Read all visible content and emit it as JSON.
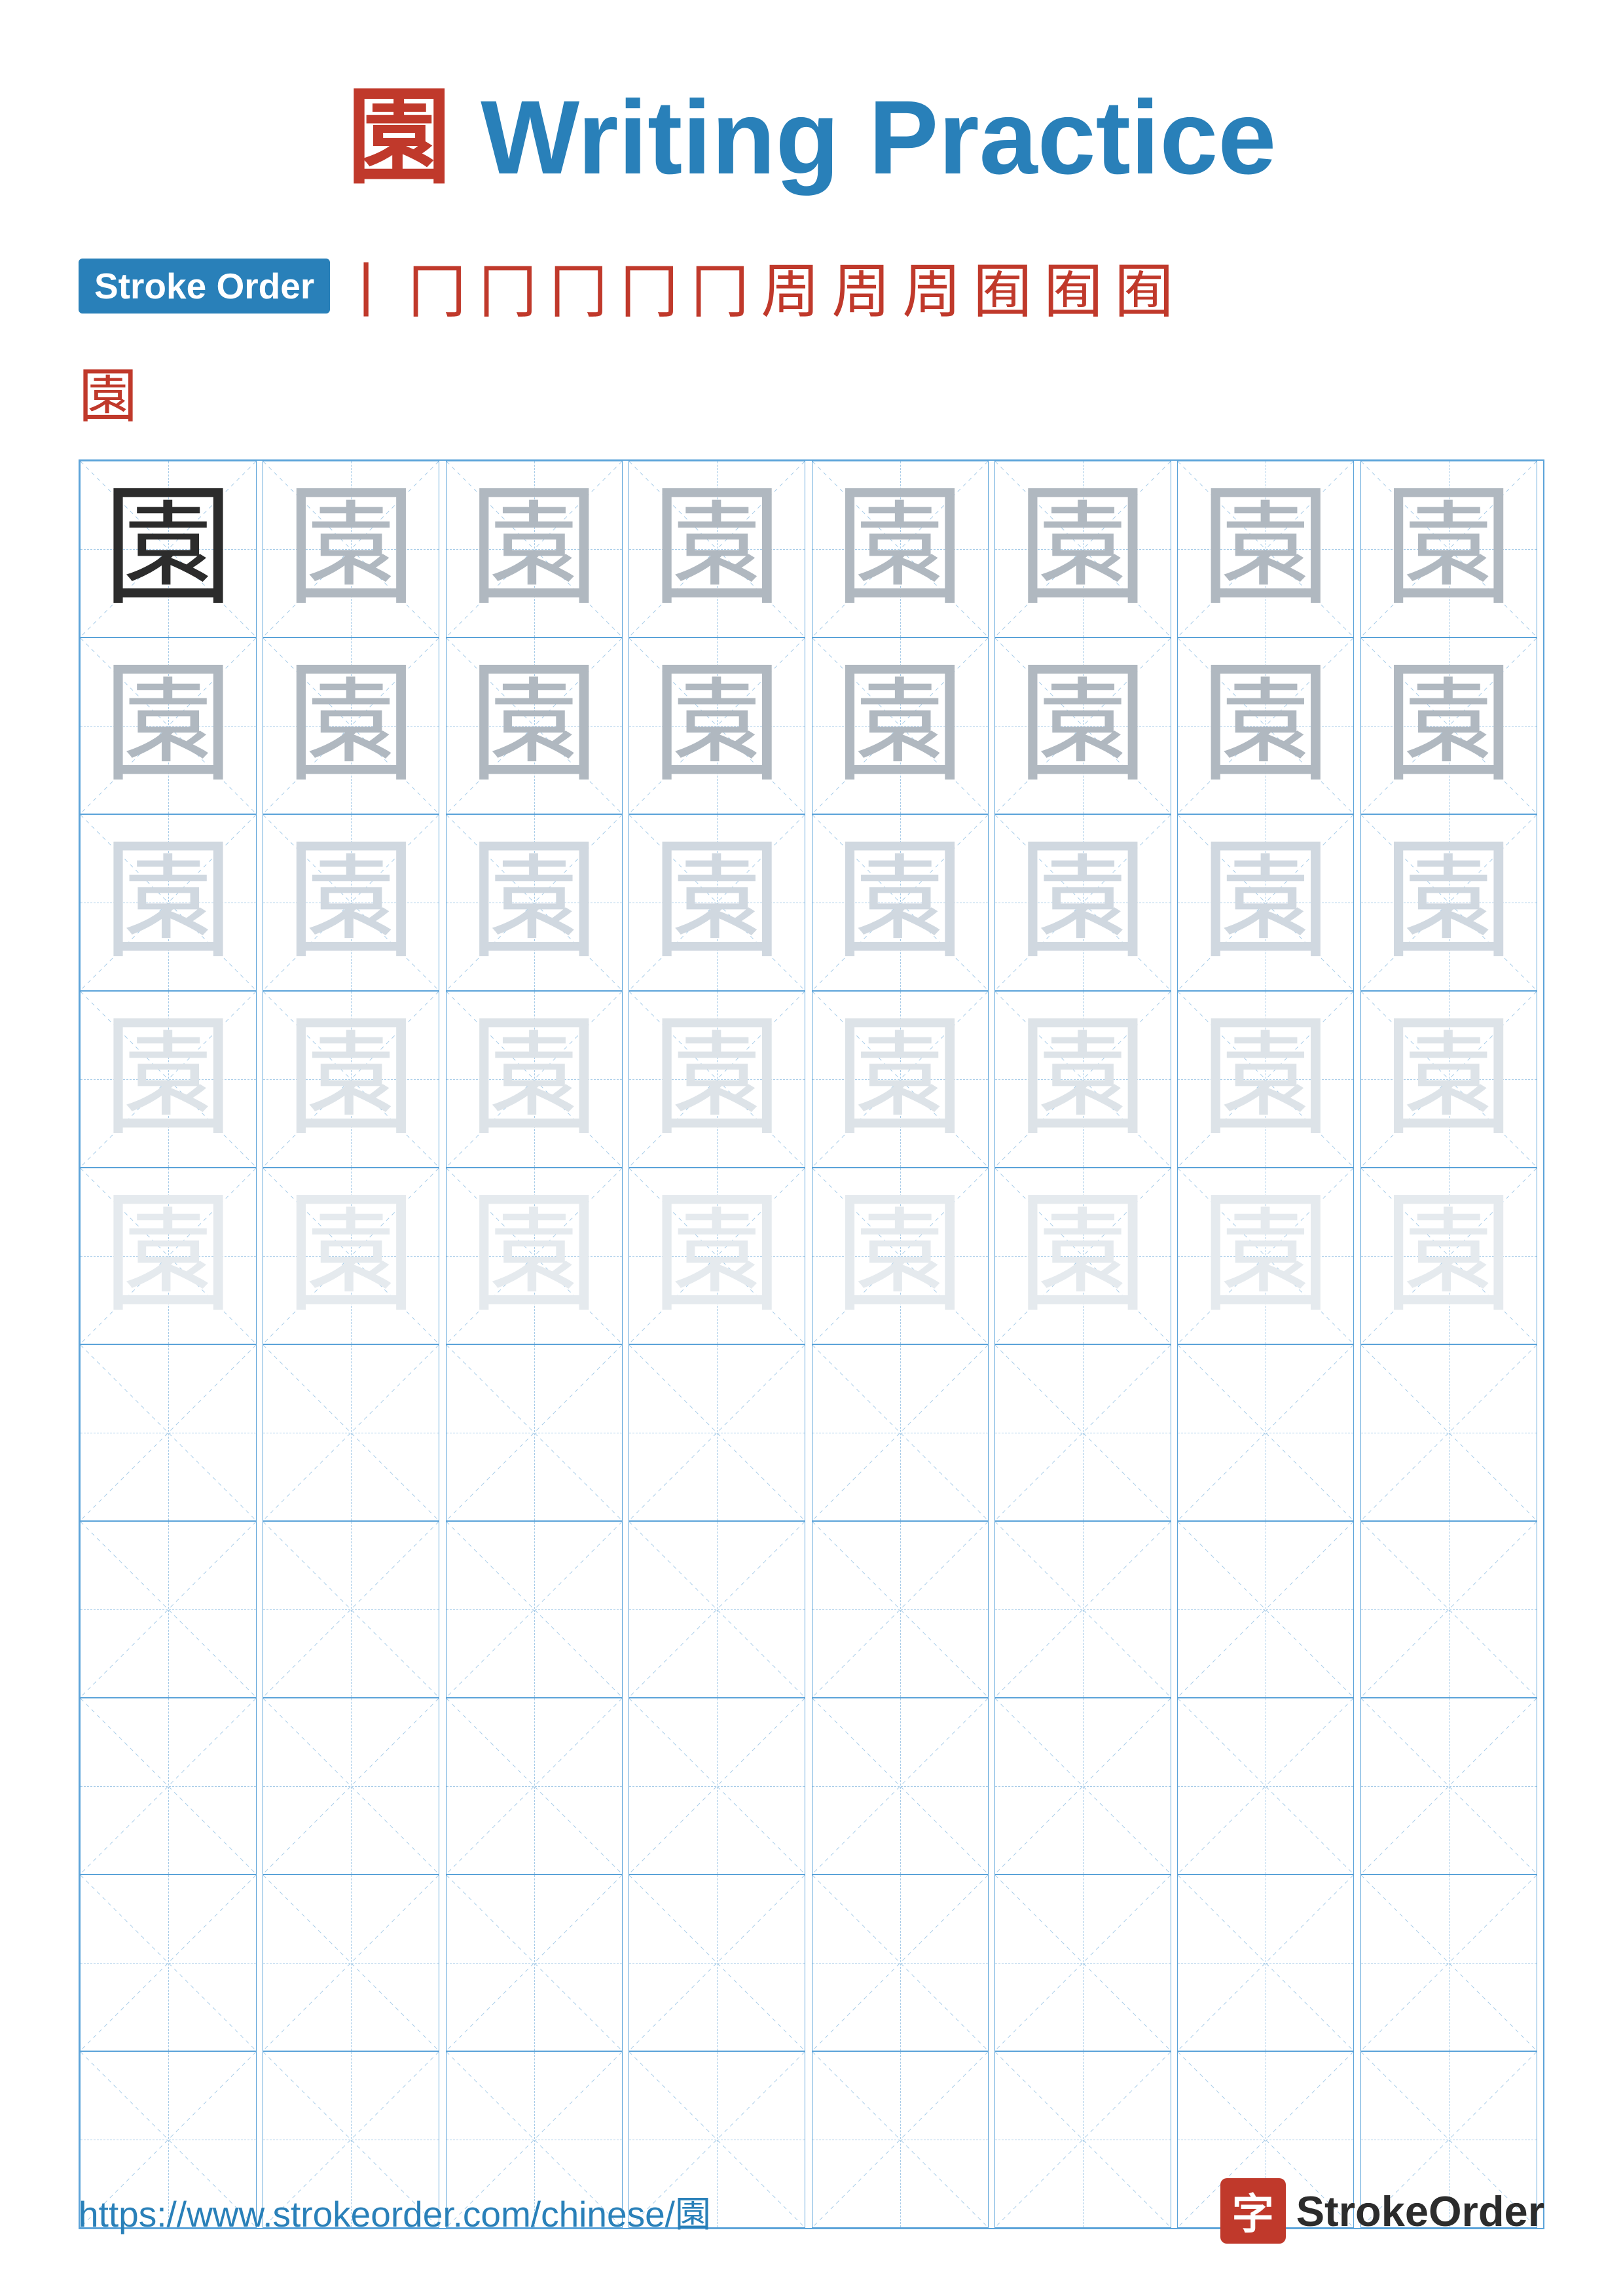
{
  "title": {
    "char": "園",
    "text": " Writing Practice"
  },
  "stroke_order": {
    "badge_label": "Stroke Order",
    "strokes": [
      "丨",
      "冂",
      "冂",
      "冂",
      "冂",
      "冂",
      "周",
      "周",
      "周",
      "囿",
      "囿",
      "囿"
    ],
    "final_char": "園"
  },
  "grid": {
    "cols": 8,
    "rows": 10,
    "char": "園",
    "char_display": "園"
  },
  "footer": {
    "url": "https://www.strokeorder.com/chinese/園",
    "logo_char": "字",
    "logo_text": "StrokeOrder"
  }
}
